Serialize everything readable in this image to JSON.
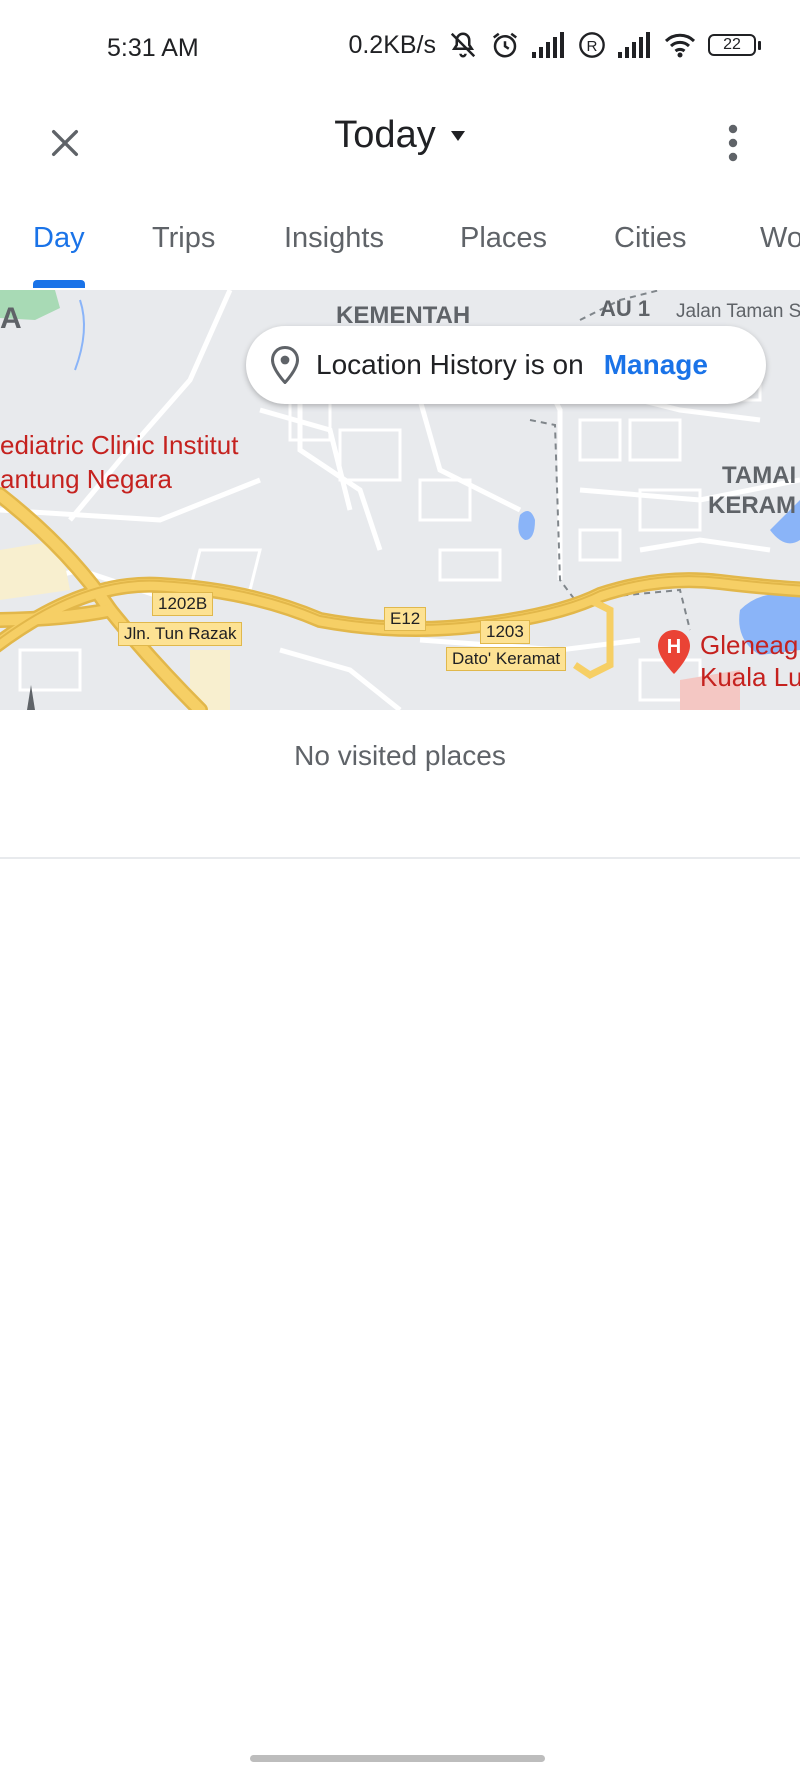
{
  "status_bar": {
    "time": "5:31 AM",
    "speed": "0.2KB/s",
    "battery": "22",
    "icons": [
      "mute-icon",
      "alarm-icon",
      "signal-icon",
      "roaming-icon",
      "signal-icon",
      "wifi-icon",
      "battery-icon"
    ]
  },
  "header": {
    "title": "Today",
    "dropdown_icon": "triangle-down-icon",
    "close_icon": "close-icon",
    "menu_icon": "more-vert-icon"
  },
  "tabs": [
    {
      "label": "Day",
      "active": true
    },
    {
      "label": "Trips",
      "active": false
    },
    {
      "label": "Insights",
      "active": false
    },
    {
      "label": "Places",
      "active": false
    },
    {
      "label": "Cities",
      "active": false
    },
    {
      "label": "Wo",
      "active": false
    }
  ],
  "map": {
    "labels": {
      "area_a": "A",
      "kementah": "KEMENTAH",
      "au1": "AU 1",
      "jalan_taman": "Jalan Taman S",
      "clinic_line1": "ediatric Clinic Institut",
      "clinic_line2": "antung Negara",
      "taman": "TAMAI",
      "keram": "KERAM",
      "gleneagles_line1": "Gleneag",
      "gleneagles_line2": "Kuala Lu"
    },
    "road_labels": {
      "r1202b": "1202B",
      "tun_razak": "Jln. Tun Razak",
      "e12": "E12",
      "r1203": "1203",
      "dato_keramat": "Dato' Keramat"
    },
    "hospital_marker": "H",
    "location_pill": {
      "text": "Location History is on",
      "action": "Manage"
    }
  },
  "empty_state": "No visited places",
  "colors": {
    "accent": "#1a73e8",
    "map_bg": "#e8eaed",
    "highway": "#f6cf65",
    "poi_red": "#c5221f"
  }
}
